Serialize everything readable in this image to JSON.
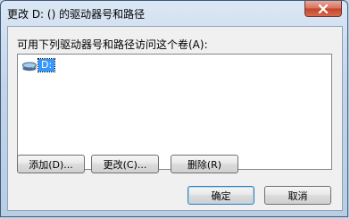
{
  "window": {
    "title": "更改 D: () 的驱动器号和路径"
  },
  "dialog": {
    "prompt": "可用下列驱动器号和路径访问这个卷(A):",
    "list_items": [
      {
        "label": "D:",
        "icon": "drive-icon"
      }
    ]
  },
  "buttons": {
    "add": "添加(D)...",
    "change": "更改(C)...",
    "remove": "删除(R)",
    "ok": "确定",
    "cancel": "取消"
  },
  "colors": {
    "selection": "#3399ff",
    "close_button": "#c4432a"
  }
}
